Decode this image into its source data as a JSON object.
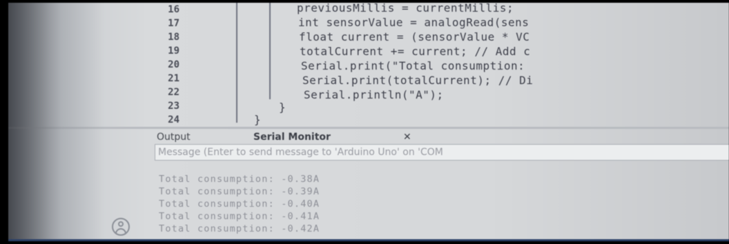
{
  "editor": {
    "lines": [
      {
        "number": "16",
        "text": "previousMillis = currentMillis;"
      },
      {
        "number": "17",
        "text": "int sensorValue = analogRead(sens"
      },
      {
        "number": "18",
        "text": "float current = (sensorValue * VC"
      },
      {
        "number": "19",
        "text": "totalCurrent += current; // Add c"
      },
      {
        "number": "20",
        "text": "Serial.print(\"Total consumption: "
      },
      {
        "number": "21",
        "text": "Serial.print(totalCurrent); // Di"
      },
      {
        "number": "22",
        "text": "Serial.println(\"A\");"
      },
      {
        "number": "23",
        "text": "}"
      },
      {
        "number": "24",
        "text": "}"
      }
    ]
  },
  "panel": {
    "tabs": {
      "output": "Output",
      "serial_monitor": "Serial Monitor",
      "close": "✕"
    },
    "message_placeholder": "Message (Enter to send message to 'Arduino Uno' on 'COM",
    "serial_lines": [
      "Total consumption: -0.38A",
      "Total consumption: -0.39A",
      "Total consumption: -0.40A",
      "Total consumption: -0.41A",
      "Total consumption: -0.42A"
    ]
  },
  "icons": {
    "avatar": "user-account-icon"
  },
  "colors": {
    "screen_background": "#d6d8da",
    "code_text": "#3d3f4a",
    "serial_text": "#8e9098",
    "taskbar": "#2a3f66"
  }
}
